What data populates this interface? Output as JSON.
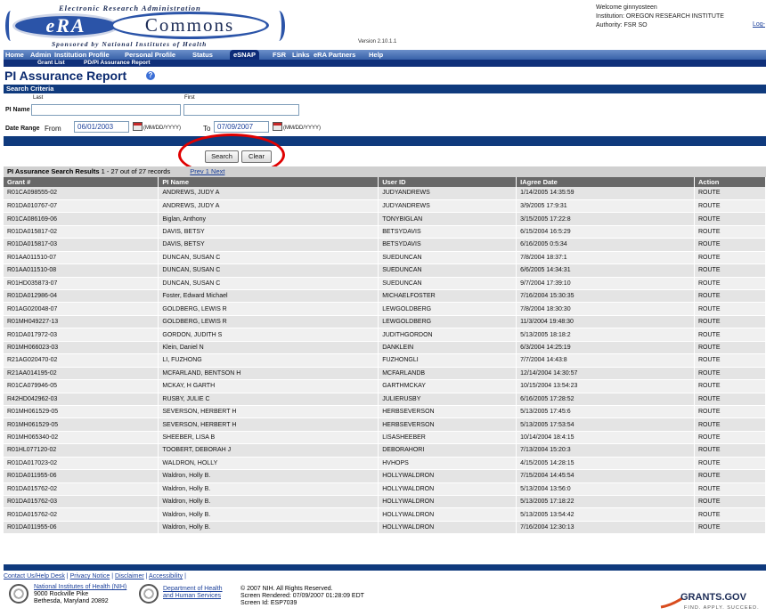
{
  "header": {
    "banner_top": "Electronic Research Administration",
    "era": "eRA",
    "commons": "Commons",
    "banner_bottom": "Sponsored by National Institutes of Health",
    "version": "Version 2.10.1.1",
    "welcome": "Welcome  ginnyosteen",
    "institution": "Institution: OREGON RESEARCH INSTITUTE",
    "authority": "Authority:  FSR SO",
    "logout": "Log-"
  },
  "nav": {
    "primary": [
      "Home",
      "Admin",
      "Institution Profile",
      "Personal Profile",
      "Status",
      "eSNAP",
      "FSR",
      "Links",
      "eRA Partners",
      "Help"
    ],
    "active": "eSNAP",
    "secondary": [
      "Grant List",
      "PD/PI Assurance Report"
    ]
  },
  "page_title": "PI Assurance Report",
  "search": {
    "section_title": "Search Criteria",
    "pi_name_label": "PI Name",
    "last_label": "Last",
    "first_label": "First",
    "last_value": "",
    "first_value": "",
    "date_range_label": "Date Range",
    "from_label": "From",
    "from_value": "06/01/2003",
    "to_label": "To",
    "to_value": "07/09/2007",
    "date_format": "(MM/DD/YYYY)",
    "search_button": "Search",
    "clear_button": "Clear"
  },
  "results": {
    "title": "PI Assurance Search Results",
    "summary": " 1 - 27 out of 27 records",
    "pager": "Prev 1 Next",
    "columns": [
      "Grant #",
      "PI Name",
      "User ID",
      "IAgree Date",
      "Action"
    ],
    "rows": [
      [
        "R01CA098555-02",
        "ANDREWS, JUDY A",
        "JUDYANDREWS",
        "1/14/2005 14:35:59",
        "ROUTE"
      ],
      [
        "R01DA010767-07",
        "ANDREWS, JUDY A",
        "JUDYANDREWS",
        "3/9/2005 17:9:31",
        "ROUTE"
      ],
      [
        "R01CA086169-06",
        "Biglan, Anthony",
        "TONYBIGLAN",
        "3/15/2005 17:22:8",
        "ROUTE"
      ],
      [
        "R01DA015817-02",
        "DAVIS, BETSY",
        "BETSYDAVIS",
        "6/15/2004 16:5:29",
        "ROUTE"
      ],
      [
        "R01DA015817-03",
        "DAVIS, BETSY",
        "BETSYDAVIS",
        "6/16/2005 0:5:34",
        "ROUTE"
      ],
      [
        "R01AA011510-07",
        "DUNCAN, SUSAN C",
        "SUEDUNCAN",
        "7/8/2004 18:37:1",
        "ROUTE"
      ],
      [
        "R01AA011510-08",
        "DUNCAN, SUSAN C",
        "SUEDUNCAN",
        "6/6/2005 14:34:31",
        "ROUTE"
      ],
      [
        "R01HD035873-07",
        "DUNCAN, SUSAN C",
        "SUEDUNCAN",
        "9/7/2004 17:39:10",
        "ROUTE"
      ],
      [
        "R01DA012986-04",
        "Foster, Edward Michael",
        "MICHAELFOSTER",
        "7/16/2004 15:30:35",
        "ROUTE"
      ],
      [
        "R01AG020048-07",
        "GOLDBERG, LEWIS R",
        "LEWGOLDBERG",
        "7/8/2004 18:30:30",
        "ROUTE"
      ],
      [
        "R01MH049227-13",
        "GOLDBERG, LEWIS R",
        "LEWGOLDBERG",
        "11/3/2004 19:48:30",
        "ROUTE"
      ],
      [
        "R01DA017972-03",
        "GORDON, JUDITH S",
        "JUDITHGORDON",
        "5/13/2005 18:18:2",
        "ROUTE"
      ],
      [
        "R01MH066023-03",
        "Klein, Daniel N",
        "DANKLEIN",
        "6/3/2004 14:25:19",
        "ROUTE"
      ],
      [
        "R21AG020470-02",
        "LI, FUZHONG",
        "FUZHONGLI",
        "7/7/2004 14:43:8",
        "ROUTE"
      ],
      [
        "R21AA014195-02",
        "MCFARLAND, BENTSON H",
        "MCFARLANDB",
        "12/14/2004 14:30:57",
        "ROUTE"
      ],
      [
        "R01CA079946-05",
        "MCKAY, H GARTH",
        "GARTHMCKAY",
        "10/15/2004 13:54:23",
        "ROUTE"
      ],
      [
        "R42HD042962-03",
        "RUSBY, JULIE C",
        "JULIERUSBY",
        "6/16/2005 17:28:52",
        "ROUTE"
      ],
      [
        "R01MH061529-05",
        "SEVERSON, HERBERT H",
        "HERBSEVERSON",
        "5/13/2005 17:45:6",
        "ROUTE"
      ],
      [
        "R01MH061529-05",
        "SEVERSON, HERBERT H",
        "HERBSEVERSON",
        "5/13/2005 17:53:54",
        "ROUTE"
      ],
      [
        "R01MH065340-02",
        "SHEEBER, LISA B",
        "LISASHEEBER",
        "10/14/2004 18:4:15",
        "ROUTE"
      ],
      [
        "R01HL077120-02",
        "TOOBERT, DEBORAH J",
        "DEBORAHORI",
        "7/13/2004 15:20:3",
        "ROUTE"
      ],
      [
        "R01DA017023-02",
        "WALDRON, HOLLY",
        "HVHOPS",
        "4/15/2005 14:28:15",
        "ROUTE"
      ],
      [
        "R01DA011955-06",
        "Waldron, Holly B.",
        "HOLLYWALDRON",
        "7/15/2004 14:45:54",
        "ROUTE"
      ],
      [
        "R01DA015762-02",
        "Waldron, Holly B.",
        "HOLLYWALDRON",
        "5/13/2004 13:56:0",
        "ROUTE"
      ],
      [
        "R01DA015762-03",
        "Waldron, Holly B.",
        "HOLLYWALDRON",
        "5/13/2005 17:18:22",
        "ROUTE"
      ],
      [
        "R01DA015762-02",
        "Waldron, Holly B.",
        "HOLLYWALDRON",
        "5/13/2005 13:54:42",
        "ROUTE"
      ],
      [
        "R01DA011955-06",
        "Waldron, Holly B.",
        "HOLLYWALDRON",
        "7/16/2004 12:30:13",
        "ROUTE"
      ]
    ]
  },
  "footer": {
    "links": [
      "Contact Us/Help Desk",
      "Privacy Notice",
      "Disclaimer",
      "Accessibility"
    ],
    "nih_name": "National Institutes of Health (NIH)",
    "nih_addr1": "9000 Rockville Pike",
    "nih_addr2": "Bethesda, Maryland 20892",
    "hhs_line1": "Department of Health",
    "hhs_line2": "and Human Services",
    "copyright": "© 2007 NIH. All Rights Reserved.",
    "rendered": "Screen Rendered: 07/09/2007 01:28:09 EDT",
    "screen_id": "Screen Id: ESP7039",
    "grants_logo": "GRANTS.GOV",
    "grants_tagline": "FIND. APPLY. SUCCEED."
  },
  "colors": {
    "navy": "#0f3a7d",
    "nav_blue": "#3862a9",
    "highlight_circle": "#e00000",
    "header_row": "#686868"
  }
}
